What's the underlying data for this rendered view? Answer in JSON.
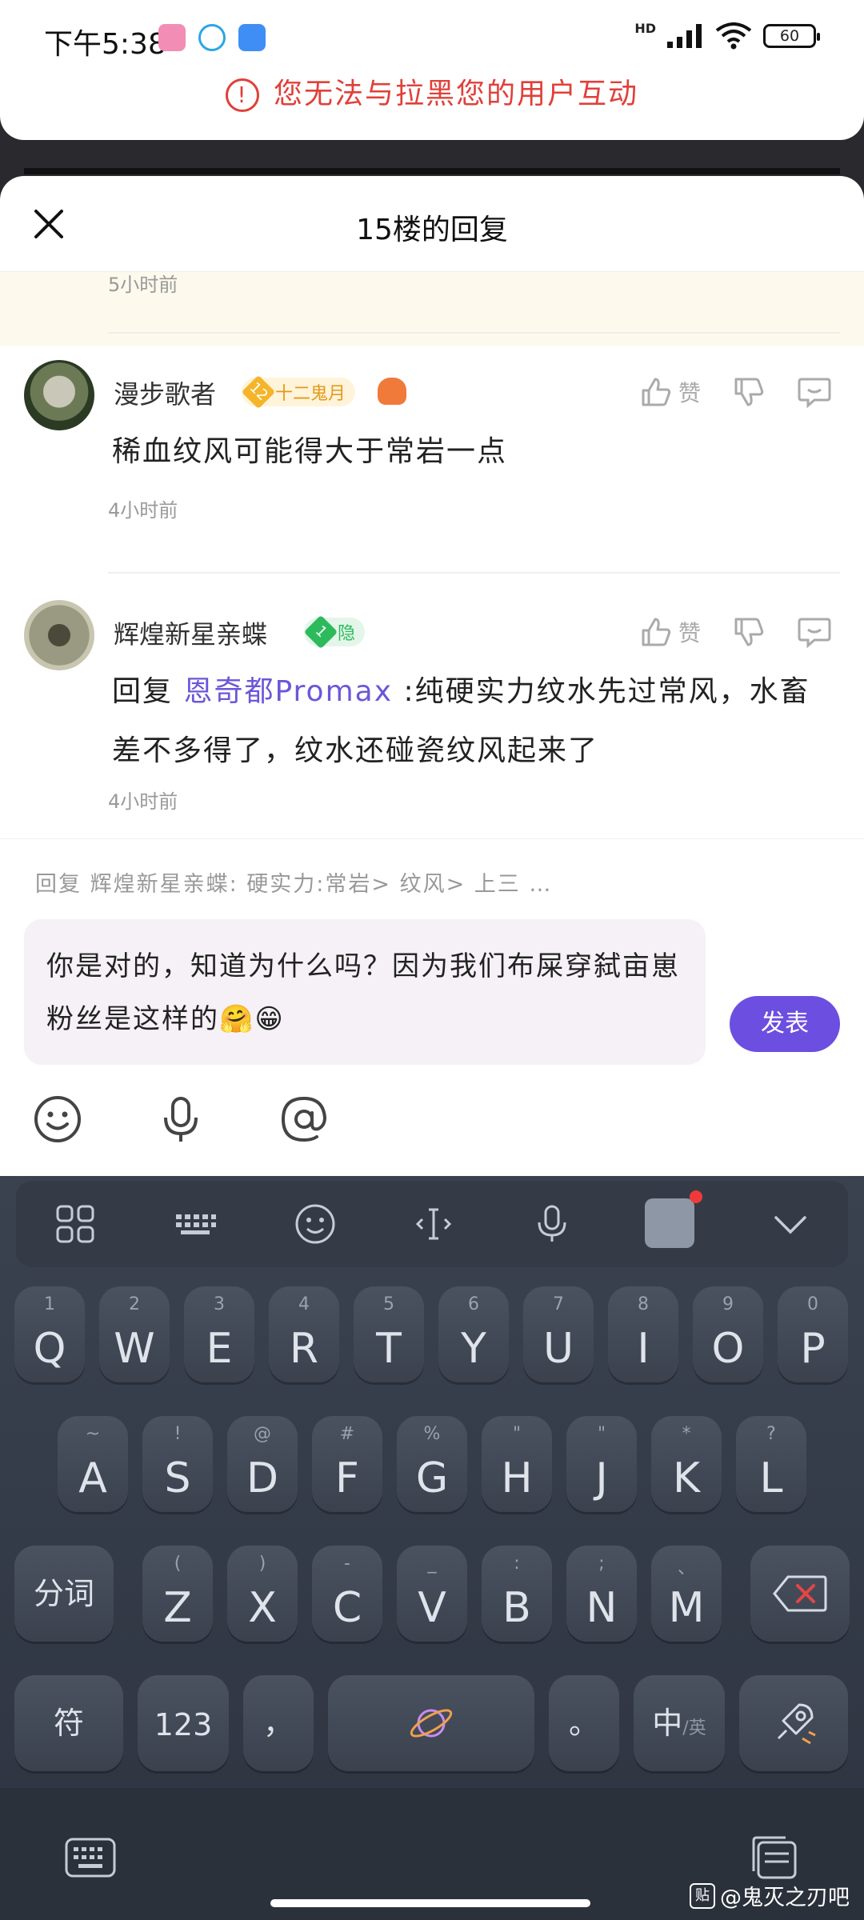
{
  "status_bar": {
    "time": "下午5:38",
    "network": "HD",
    "battery": "60"
  },
  "warning": {
    "text": "您无法与拉黑您的用户互动"
  },
  "sheet": {
    "title": "15楼的回复",
    "prev_time": "5小时前"
  },
  "comments": [
    {
      "username": "漫步歌者",
      "badge_level": "12",
      "badge_text": "十二鬼月",
      "like_label": "赞",
      "text": "稀血纹风可能得大于常岩一点",
      "time": "4小时前"
    },
    {
      "username": "辉煌新星亲蝶",
      "badge_level": "1",
      "badge_text": "隐",
      "like_label": "赞",
      "reply_prefix": "回复",
      "mention": "恩奇都Promax",
      "text": " :纯硬实力纹水先过常风，水畜差不多得了，纹水还碰瓷纹风起来了",
      "time": "4小时前"
    }
  ],
  "reply": {
    "hint": "回复 辉煌新星亲蝶: 硬实力:常岩> 纹风> 上三 …",
    "input_text": "你是对的，知道为什么吗？因为我们布屎穿弑亩崽粉丝是这样的🤗😁",
    "send_label": "发表"
  },
  "keyboard": {
    "row1": [
      {
        "sub": "1",
        "main": "Q"
      },
      {
        "sub": "2",
        "main": "W"
      },
      {
        "sub": "3",
        "main": "E"
      },
      {
        "sub": "4",
        "main": "R"
      },
      {
        "sub": "5",
        "main": "T"
      },
      {
        "sub": "6",
        "main": "Y"
      },
      {
        "sub": "7",
        "main": "U"
      },
      {
        "sub": "8",
        "main": "I"
      },
      {
        "sub": "9",
        "main": "O"
      },
      {
        "sub": "0",
        "main": "P"
      }
    ],
    "row2": [
      {
        "sub": "~",
        "main": "A"
      },
      {
        "sub": "!",
        "main": "S"
      },
      {
        "sub": "@",
        "main": "D"
      },
      {
        "sub": "#",
        "main": "F"
      },
      {
        "sub": "%",
        "main": "G"
      },
      {
        "sub": "\"",
        "main": "H"
      },
      {
        "sub": "\"",
        "main": "J"
      },
      {
        "sub": "*",
        "main": "K"
      },
      {
        "sub": "?",
        "main": "L"
      }
    ],
    "row3": [
      {
        "sub": "(",
        "main": "Z"
      },
      {
        "sub": ")",
        "main": "X"
      },
      {
        "sub": "-",
        "main": "C"
      },
      {
        "sub": "_",
        "main": "V"
      },
      {
        "sub": ":",
        "main": "B"
      },
      {
        "sub": ";",
        "main": "N"
      },
      {
        "sub": "、",
        "main": "M"
      }
    ],
    "split_label": "分词",
    "symbol_label": "符",
    "num_label": "123",
    "comma_label": "，",
    "period_label": "。",
    "lang_label": "中",
    "lang_sub": "/英"
  },
  "watermark": "@鬼灭之刃吧",
  "watermark_icon": "贴",
  "colors": {
    "accent": "#6c4ee0",
    "warning": "#e0403a",
    "mention": "#6b57d8"
  }
}
